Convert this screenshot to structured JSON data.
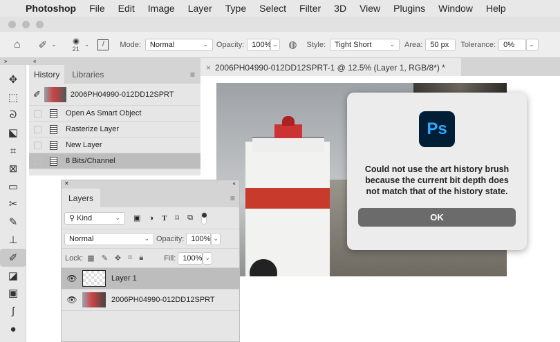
{
  "menubar": {
    "apple": "",
    "app": "Photoshop",
    "items": [
      "File",
      "Edit",
      "Image",
      "Layer",
      "Type",
      "Select",
      "Filter",
      "3D",
      "View",
      "Plugins",
      "Window",
      "Help"
    ]
  },
  "options": {
    "brush_size": "21",
    "mode_label": "Mode:",
    "mode": "Normal",
    "opacity_label": "Opacity:",
    "opacity": "100%",
    "style_label": "Style:",
    "style": "Tight Short",
    "area_label": "Area:",
    "area": "50 px",
    "tolerance_label": "Tolerance:",
    "tolerance": "0%"
  },
  "history": {
    "tabs": [
      "History",
      "Libraries"
    ],
    "snapshot": "2006PH04990-012DD12SPRT",
    "states": [
      "Open As Smart Object",
      "Rasterize Layer",
      "New Layer",
      "8 Bits/Channel"
    ]
  },
  "document": {
    "tab_title": "2006PH04990-012DD12SPRT-1 @ 12.5% (Layer 1, RGB/8*) *",
    "close": "×"
  },
  "layers": {
    "tab": "Layers",
    "kind": "Kind",
    "blend": "Normal",
    "opacity_label": "Opacity:",
    "opacity": "100%",
    "lock_label": "Lock:",
    "fill_label": "Fill:",
    "fill": "100%",
    "items": [
      "Layer 1",
      "2006PH04990-012DD12SPRT"
    ]
  },
  "dialog": {
    "logo": "Ps",
    "message": "Could not use the art history brush because the current bit depth does not match that of the history state.",
    "ok": "OK"
  }
}
